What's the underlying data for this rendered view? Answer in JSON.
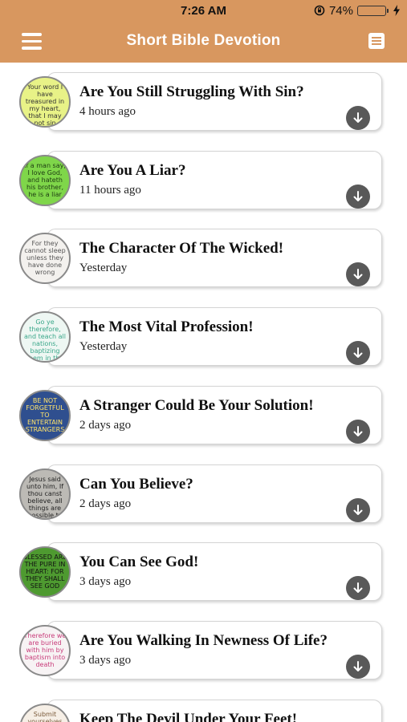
{
  "status": {
    "time": "7:26 AM",
    "battery": "74%",
    "battery_level": 0.74,
    "battery_color": "#3fce3f"
  },
  "nav": {
    "title": "Short Bible Devotion",
    "background": "#d8975f"
  },
  "devotions": [
    {
      "title": "Are You Still Struggling With Sin?",
      "time": "4 hours ago",
      "thumb_text": "Your word I have treasured in my heart, that I may not sin against You",
      "thumb_bg": "#e8f287",
      "thumb_fg": "#333333"
    },
    {
      "title": "Are You A Liar?",
      "time": "11 hours ago",
      "thumb_text": "If a man say, I love God, and hateth his brother, he is a liar",
      "thumb_bg": "#7fd64a",
      "thumb_fg": "#1d3b12"
    },
    {
      "title": "The Character Of The Wicked!",
      "time": "Yesterday",
      "thumb_text": "For they cannot sleep unless they have done wrong",
      "thumb_bg": "#f3f1ee",
      "thumb_fg": "#555555"
    },
    {
      "title": "The Most Vital Profession!",
      "time": "Yesterday",
      "thumb_text": "Go ye therefore, and teach all nations, baptizing them in the name of the Father",
      "thumb_bg": "#eef7f3",
      "thumb_fg": "#3aa78a"
    },
    {
      "title": "A Stranger Could Be Your Solution!",
      "time": "2 days ago",
      "thumb_text": "BE NOT FORGETFUL TO ENTERTAIN STRANGERS",
      "thumb_bg": "#2f4f8f",
      "thumb_fg": "#ffe36b"
    },
    {
      "title": "Can You Believe?",
      "time": "2 days ago",
      "thumb_text": "Jesus said unto him, If thou canst believe, all things are possible to him that believeth",
      "thumb_bg": "#bcbab5",
      "thumb_fg": "#222222"
    },
    {
      "title": "You Can See God!",
      "time": "3 days ago",
      "thumb_text": "BLESSED ARE THE PURE IN HEART: FOR THEY SHALL SEE GOD",
      "thumb_bg": "#4e9a30",
      "thumb_fg": "#111111"
    },
    {
      "title": "Are You Walking In Newness Of Life?",
      "time": "3 days ago",
      "thumb_text": "Therefore we are buried with him by baptism into death",
      "thumb_bg": "#f7f3f4",
      "thumb_fg": "#c83b7a"
    },
    {
      "title": "Keep The Devil Under Your Feet!",
      "time": "",
      "thumb_text": "Submit yourselves therefore to God",
      "thumb_bg": "#f6efe6",
      "thumb_fg": "#7a5a3a"
    }
  ]
}
